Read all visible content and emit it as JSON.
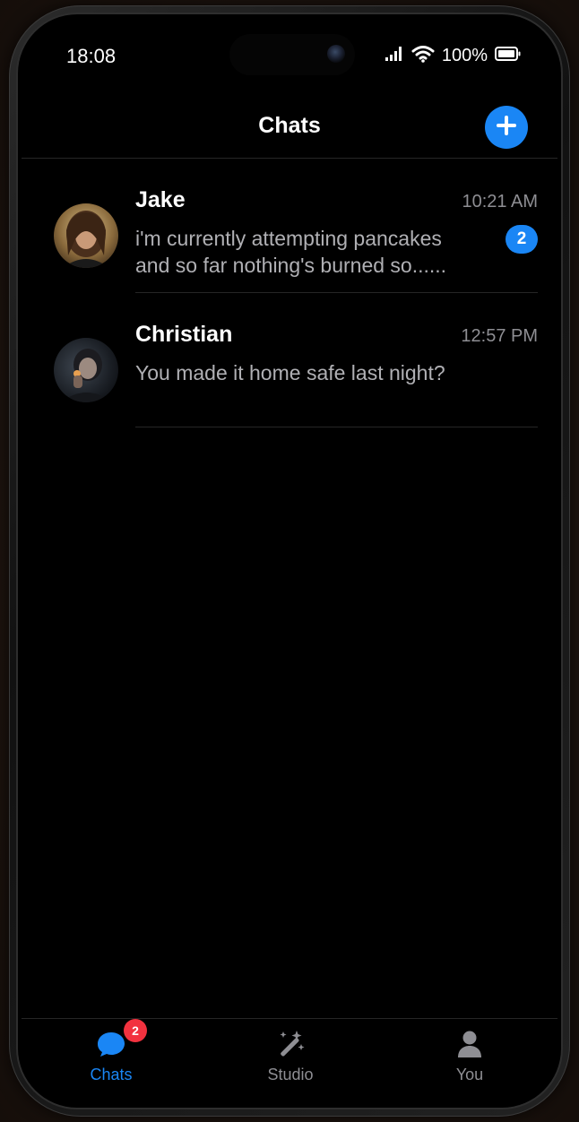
{
  "status_bar": {
    "time": "18:08",
    "battery_percent": "100%",
    "icons": [
      "signal-icon",
      "wifi-icon",
      "battery-icon"
    ]
  },
  "header": {
    "title": "Chats",
    "new_chat_icon": "plus-icon"
  },
  "chats": [
    {
      "name": "Jake",
      "time": "10:21 AM",
      "preview": "i'm currently attempting pancakes and so far nothing's burned so......",
      "unread": "2"
    },
    {
      "name": "Christian",
      "time": "12:57 PM",
      "preview": "You made it home safe last night?",
      "unread": ""
    }
  ],
  "tab_bar": {
    "tabs": [
      {
        "label": "Chats",
        "icon": "chat-bubble-icon",
        "badge": "2",
        "active": true
      },
      {
        "label": "Studio",
        "icon": "magic-wand-icon",
        "badge": "",
        "active": false
      },
      {
        "label": "You",
        "icon": "person-icon",
        "badge": "",
        "active": false
      }
    ]
  },
  "colors": {
    "accent": "#1a86f5",
    "badge_red": "#f2323f",
    "background": "#000000"
  }
}
